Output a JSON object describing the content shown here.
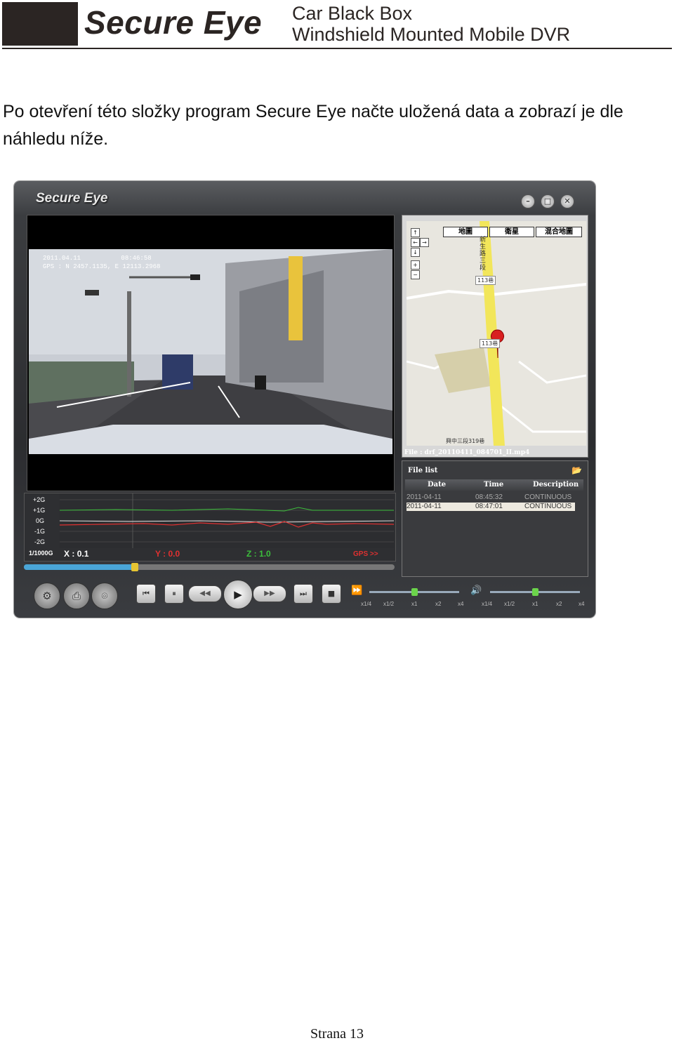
{
  "header": {
    "brand": "Secure Eye",
    "sub_line1": "Car Black Box",
    "sub_line2": "Windshield Mounted Mobile DVR"
  },
  "intro_text": "Po otevření této složky program Secure Eye načte uložená data a zobrazí je dle náhledu níže.",
  "app": {
    "title": "Secure Eye",
    "window_buttons": [
      "minimize-icon",
      "maximize-icon",
      "close-icon"
    ],
    "osd": {
      "line1_date": "2011.04.11",
      "line1_time": "08:46:58",
      "line2": "GPS : N 2457.1135, E 12113.2968"
    },
    "map": {
      "tabs": [
        "地圖",
        "衛星",
        "混合地圖"
      ],
      "controls": [
        "↑",
        "←",
        "→",
        "↓",
        "+",
        "−"
      ],
      "road_labels": [
        "新生路三段",
        "113巷",
        "113巷",
        "興中三段319巷"
      ]
    },
    "file_name": "File : drf_20110411_084701_II.mp4",
    "file_list": {
      "title": "File list",
      "columns": [
        "Date",
        "Time",
        "Description"
      ],
      "rows": [
        {
          "date": "2011-04-11",
          "time": "08:45:32",
          "description": "CONTINUOUS",
          "selected": false
        },
        {
          "date": "2011-04-11",
          "time": "08:47:01",
          "description": "CONTINUOUS",
          "selected": true
        }
      ]
    },
    "gsensor": {
      "scale_labels": [
        "+2G",
        "+1G",
        "0G",
        "-1G",
        "-2G"
      ],
      "unit": "1/1000G",
      "x_label": "X :",
      "x_value": "0.1",
      "y_label": "Y :",
      "y_value": "0.0",
      "z_label": "Z :",
      "z_value": "1.0",
      "gps_label": "GPS >>",
      "colors": {
        "x": "#ffffff",
        "y": "#e03030",
        "z": "#3cbf3c"
      }
    },
    "seek_progress": 0.3,
    "speed_ticks": [
      "x1/4",
      "x1/2",
      "x1",
      "x2",
      "x4"
    ],
    "volume_ticks": [
      "x1/4",
      "x1/2",
      "x1",
      "x2",
      "x4"
    ],
    "speed_level": 0.5,
    "volume_level": 0.5,
    "controls": {
      "settings": "gear-icon",
      "print": "printer-icon",
      "snapshot": "camera-icon",
      "prev": "⏮",
      "pause": "⏸",
      "rewind": "◀◀",
      "play": "▶",
      "forward": "▶▶",
      "next": "⏭",
      "stop": "■"
    }
  },
  "footer": "Strana 13"
}
